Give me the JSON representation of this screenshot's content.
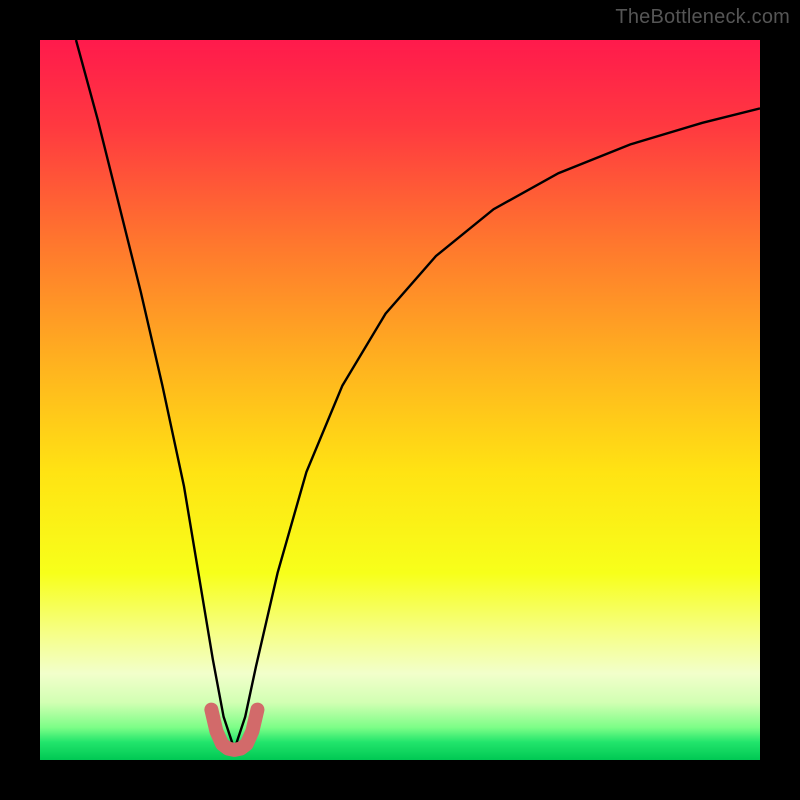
{
  "watermark": "TheBottleneck.com",
  "colors": {
    "frame": "#000000",
    "gradient_stops": [
      {
        "offset": 0.0,
        "color": "#ff1a4c"
      },
      {
        "offset": 0.12,
        "color": "#ff3940"
      },
      {
        "offset": 0.28,
        "color": "#ff762e"
      },
      {
        "offset": 0.45,
        "color": "#ffb21f"
      },
      {
        "offset": 0.6,
        "color": "#ffe313"
      },
      {
        "offset": 0.74,
        "color": "#f7ff1a"
      },
      {
        "offset": 0.82,
        "color": "#f6ff82"
      },
      {
        "offset": 0.88,
        "color": "#f2ffcb"
      },
      {
        "offset": 0.92,
        "color": "#d2ffb3"
      },
      {
        "offset": 0.955,
        "color": "#7cfe87"
      },
      {
        "offset": 0.975,
        "color": "#22e56c"
      },
      {
        "offset": 1.0,
        "color": "#00c853"
      }
    ],
    "curve": "#000000",
    "bottom_marker": "#d26a6a"
  },
  "chart_data": {
    "type": "line",
    "title": "",
    "xlabel": "",
    "ylabel": "",
    "xlim": [
      0,
      100
    ],
    "ylim": [
      0,
      100
    ],
    "x_optimum": 27,
    "series": [
      {
        "name": "bottleneck-curve",
        "x": [
          5,
          8,
          11,
          14,
          17,
          20,
          22,
          24,
          25.5,
          27,
          28.5,
          30,
          33,
          37,
          42,
          48,
          55,
          63,
          72,
          82,
          92,
          100
        ],
        "y": [
          100,
          89,
          77,
          65,
          52,
          38,
          26,
          14,
          6,
          1.5,
          6,
          13,
          26,
          40,
          52,
          62,
          70,
          76.5,
          81.5,
          85.5,
          88.5,
          90.5
        ]
      }
    ],
    "bottom_marker": {
      "name": "optimal-zone",
      "x": [
        23.8,
        24.5,
        25.3,
        26.1,
        27.0,
        27.9,
        28.7,
        29.5,
        30.2
      ],
      "y": [
        7.0,
        4.0,
        2.2,
        1.6,
        1.4,
        1.6,
        2.2,
        4.0,
        7.0
      ]
    }
  }
}
